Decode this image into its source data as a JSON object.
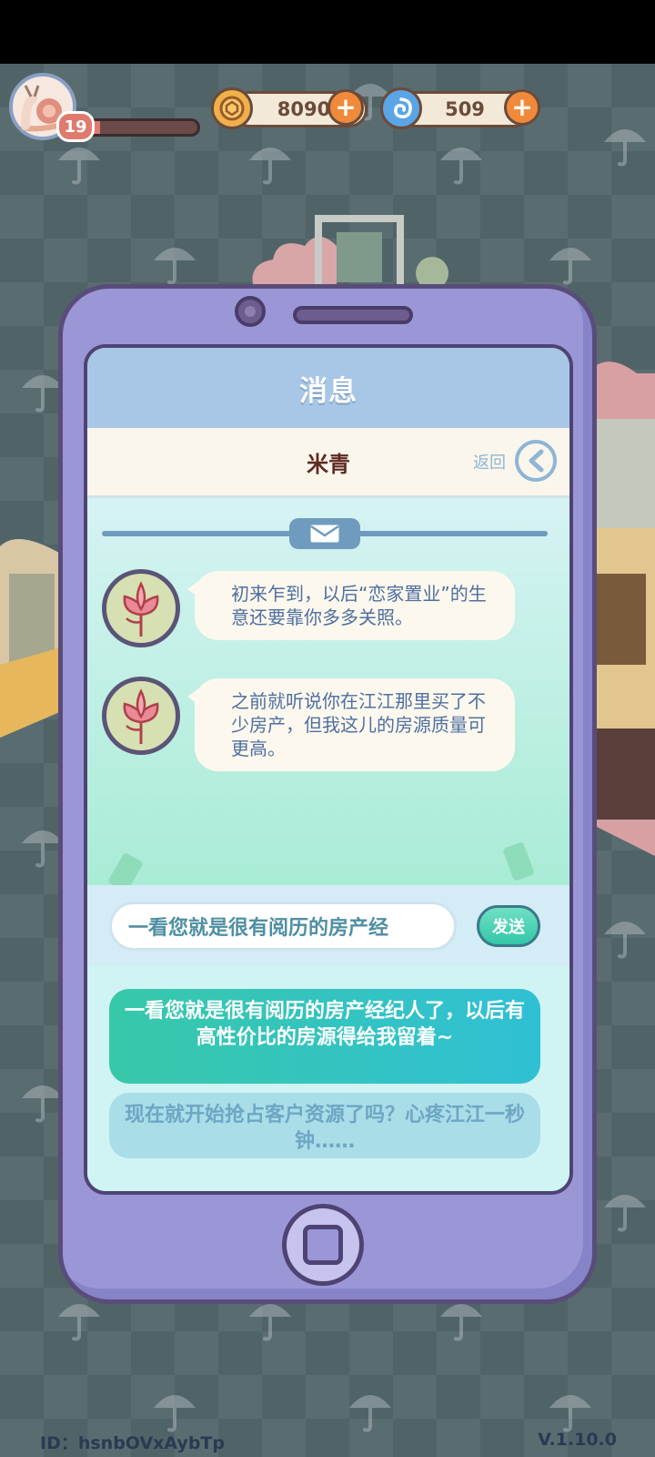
{
  "hud": {
    "level": "19",
    "xp_progress": 0.12,
    "coins": "8090",
    "gems": "509",
    "avatar_icon": "snail-icon",
    "coin_icon": "coin-icon",
    "gem_icon": "swirl-gem-icon"
  },
  "screen": {
    "title": "消息",
    "contact": "米青",
    "back_label": "返回"
  },
  "messages": [
    {
      "text": "初来乍到，以后“恋家置业”的生意还要靠你多多关照。"
    },
    {
      "text": "之前就听说你在江江那里买了不少房产，但我这儿的房源质量可更高。"
    }
  ],
  "input": {
    "value": "一看您就是很有阅历的房产经",
    "send_label": "发送"
  },
  "options": [
    "一看您就是很有阅历的房产经纪人了，以后有高性价比的房源得给我留着~",
    "现在就开始抢占客户资源了吗？心疼江江一秒钟……"
  ],
  "footer": {
    "id": "ID：hsnbOVxAybTp",
    "version": "V.1.10.0"
  },
  "colors": {
    "phone_body": "#9b97d6",
    "accent_teal": "#37c8a9",
    "message_text": "#4e6fa2"
  }
}
